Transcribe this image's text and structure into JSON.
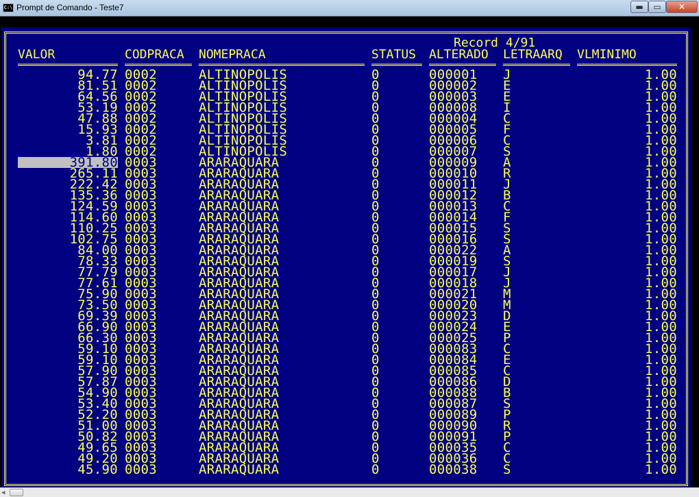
{
  "window": {
    "title": "Prompt de Comando - Teste7",
    "icon_text": "C:\\",
    "minimize_symbol": "▬",
    "maximize_symbol": "▭",
    "close_symbol": "✕"
  },
  "browse": {
    "record_text": "Record 4/91",
    "columns": {
      "valor": "VALOR",
      "codpraca": "CODPRACA",
      "nomepraca": "NOMEPRACA",
      "status": "STATUS",
      "alterado": "ALTERADO",
      "letraarq": "LETRAARQ",
      "vlminimo": "VLMINIMO"
    },
    "selected_row": 8,
    "rows": [
      {
        "valor": "94.77",
        "codpraca": "0002",
        "nomepraca": "ALTINOPOLIS",
        "status": "0",
        "alterado": "000001",
        "letraarq": "J",
        "vlminimo": "1.00"
      },
      {
        "valor": "81.51",
        "codpraca": "0002",
        "nomepraca": "ALTINOPOLIS",
        "status": "0",
        "alterado": "000002",
        "letraarq": "E",
        "vlminimo": "1.00"
      },
      {
        "valor": "64.56",
        "codpraca": "0002",
        "nomepraca": "ALTINOPOLIS",
        "status": "0",
        "alterado": "000003",
        "letraarq": "E",
        "vlminimo": "1.00"
      },
      {
        "valor": "53.19",
        "codpraca": "0002",
        "nomepraca": "ALTINOPOLIS",
        "status": "0",
        "alterado": "000008",
        "letraarq": "I",
        "vlminimo": "1.00"
      },
      {
        "valor": "47.88",
        "codpraca": "0002",
        "nomepraca": "ALTINOPOLIS",
        "status": "0",
        "alterado": "000004",
        "letraarq": "C",
        "vlminimo": "1.00"
      },
      {
        "valor": "15.93",
        "codpraca": "0002",
        "nomepraca": "ALTINOPOLIS",
        "status": "0",
        "alterado": "000005",
        "letraarq": "F",
        "vlminimo": "1.00"
      },
      {
        "valor": "3.81",
        "codpraca": "0002",
        "nomepraca": "ALTINOPOLIS",
        "status": "0",
        "alterado": "000006",
        "letraarq": "C",
        "vlminimo": "1.00"
      },
      {
        "valor": "1.80",
        "codpraca": "0002",
        "nomepraca": "ALTINOPOLIS",
        "status": "0",
        "alterado": "000007",
        "letraarq": "S",
        "vlminimo": "1.00"
      },
      {
        "valor": "391.80",
        "codpraca": "0003",
        "nomepraca": "ARARAQUARA",
        "status": "0",
        "alterado": "000009",
        "letraarq": "A",
        "vlminimo": "1.00"
      },
      {
        "valor": "265.11",
        "codpraca": "0003",
        "nomepraca": "ARARAQUARA",
        "status": "0",
        "alterado": "000010",
        "letraarq": "R",
        "vlminimo": "1.00"
      },
      {
        "valor": "222.42",
        "codpraca": "0003",
        "nomepraca": "ARARAQUARA",
        "status": "0",
        "alterado": "000011",
        "letraarq": "J",
        "vlminimo": "1.00"
      },
      {
        "valor": "135.36",
        "codpraca": "0003",
        "nomepraca": "ARARAQUARA",
        "status": "0",
        "alterado": "000012",
        "letraarq": "B",
        "vlminimo": "1.00"
      },
      {
        "valor": "124.59",
        "codpraca": "0003",
        "nomepraca": "ARARAQUARA",
        "status": "0",
        "alterado": "000013",
        "letraarq": "C",
        "vlminimo": "1.00"
      },
      {
        "valor": "114.60",
        "codpraca": "0003",
        "nomepraca": "ARARAQUARA",
        "status": "0",
        "alterado": "000014",
        "letraarq": "F",
        "vlminimo": "1.00"
      },
      {
        "valor": "110.25",
        "codpraca": "0003",
        "nomepraca": "ARARAQUARA",
        "status": "0",
        "alterado": "000015",
        "letraarq": "S",
        "vlminimo": "1.00"
      },
      {
        "valor": "102.75",
        "codpraca": "0003",
        "nomepraca": "ARARAQUARA",
        "status": "0",
        "alterado": "000016",
        "letraarq": "S",
        "vlminimo": "1.00"
      },
      {
        "valor": "84.00",
        "codpraca": "0003",
        "nomepraca": "ARARAQUARA",
        "status": "0",
        "alterado": "000022",
        "letraarq": "A",
        "vlminimo": "1.00"
      },
      {
        "valor": "78.33",
        "codpraca": "0003",
        "nomepraca": "ARARAQUARA",
        "status": "0",
        "alterado": "000019",
        "letraarq": "S",
        "vlminimo": "1.00"
      },
      {
        "valor": "77.79",
        "codpraca": "0003",
        "nomepraca": "ARARAQUARA",
        "status": "0",
        "alterado": "000017",
        "letraarq": "J",
        "vlminimo": "1.00"
      },
      {
        "valor": "77.61",
        "codpraca": "0003",
        "nomepraca": "ARARAQUARA",
        "status": "0",
        "alterado": "000018",
        "letraarq": "J",
        "vlminimo": "1.00"
      },
      {
        "valor": "75.90",
        "codpraca": "0003",
        "nomepraca": "ARARAQUARA",
        "status": "0",
        "alterado": "000021",
        "letraarq": "M",
        "vlminimo": "1.00"
      },
      {
        "valor": "73.50",
        "codpraca": "0003",
        "nomepraca": "ARARAQUARA",
        "status": "0",
        "alterado": "000020",
        "letraarq": "M",
        "vlminimo": "1.00"
      },
      {
        "valor": "69.39",
        "codpraca": "0003",
        "nomepraca": "ARARAQUARA",
        "status": "0",
        "alterado": "000023",
        "letraarq": "D",
        "vlminimo": "1.00"
      },
      {
        "valor": "66.90",
        "codpraca": "0003",
        "nomepraca": "ARARAQUARA",
        "status": "0",
        "alterado": "000024",
        "letraarq": "E",
        "vlminimo": "1.00"
      },
      {
        "valor": "66.30",
        "codpraca": "0003",
        "nomepraca": "ARARAQUARA",
        "status": "0",
        "alterado": "000025",
        "letraarq": "P",
        "vlminimo": "1.00"
      },
      {
        "valor": "59.10",
        "codpraca": "0003",
        "nomepraca": "ARARAQUARA",
        "status": "0",
        "alterado": "000083",
        "letraarq": "C",
        "vlminimo": "1.00"
      },
      {
        "valor": "59.10",
        "codpraca": "0003",
        "nomepraca": "ARARAQUARA",
        "status": "0",
        "alterado": "000084",
        "letraarq": "E",
        "vlminimo": "1.00"
      },
      {
        "valor": "57.90",
        "codpraca": "0003",
        "nomepraca": "ARARAQUARA",
        "status": "0",
        "alterado": "000085",
        "letraarq": "C",
        "vlminimo": "1.00"
      },
      {
        "valor": "57.87",
        "codpraca": "0003",
        "nomepraca": "ARARAQUARA",
        "status": "0",
        "alterado": "000086",
        "letraarq": "D",
        "vlminimo": "1.00"
      },
      {
        "valor": "54.90",
        "codpraca": "0003",
        "nomepraca": "ARARAQUARA",
        "status": "0",
        "alterado": "000088",
        "letraarq": "B",
        "vlminimo": "1.00"
      },
      {
        "valor": "53.40",
        "codpraca": "0003",
        "nomepraca": "ARARAQUARA",
        "status": "0",
        "alterado": "000087",
        "letraarq": "S",
        "vlminimo": "1.00"
      },
      {
        "valor": "52.20",
        "codpraca": "0003",
        "nomepraca": "ARARAQUARA",
        "status": "0",
        "alterado": "000089",
        "letraarq": "P",
        "vlminimo": "1.00"
      },
      {
        "valor": "51.00",
        "codpraca": "0003",
        "nomepraca": "ARARAQUARA",
        "status": "0",
        "alterado": "000090",
        "letraarq": "R",
        "vlminimo": "1.00"
      },
      {
        "valor": "50.82",
        "codpraca": "0003",
        "nomepraca": "ARARAQUARA",
        "status": "0",
        "alterado": "000091",
        "letraarq": "P",
        "vlminimo": "1.00"
      },
      {
        "valor": "49.65",
        "codpraca": "0003",
        "nomepraca": "ARARAQUARA",
        "status": "0",
        "alterado": "000035",
        "letraarq": "C",
        "vlminimo": "1.00"
      },
      {
        "valor": "49.20",
        "codpraca": "0003",
        "nomepraca": "ARARAQUARA",
        "status": "0",
        "alterado": "000036",
        "letraarq": "C",
        "vlminimo": "1.00"
      },
      {
        "valor": "45.90",
        "codpraca": "0003",
        "nomepraca": "ARARAQUARA",
        "status": "0",
        "alterado": "000038",
        "letraarq": "S",
        "vlminimo": "1.00"
      }
    ]
  },
  "colors": {
    "console_bg": "#000080",
    "console_fg": "#ffff55",
    "highlight_bg": "#c0c0c0"
  }
}
